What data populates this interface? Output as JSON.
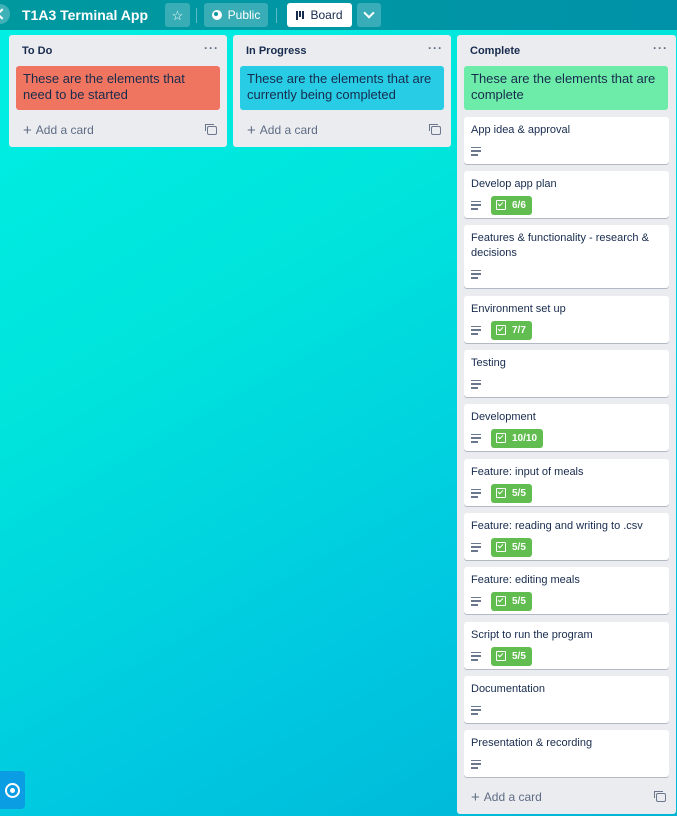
{
  "header": {
    "board_title": "T1A3 Terminal App",
    "visibility_label": "Public",
    "view_label": "Board"
  },
  "lists": [
    {
      "title": "To Do",
      "cover_card": {
        "text": "These are the elements that need to be started",
        "color": "#f07560"
      },
      "add_card_label": "Add a card"
    },
    {
      "title": "In Progress",
      "cover_card": {
        "text": "These are the elements that are currently being completed",
        "color": "#29cce5"
      },
      "add_card_label": "Add a card"
    },
    {
      "title": "Complete",
      "cover_card": {
        "text": "These are the elements that are complete",
        "color": "#6deca9"
      },
      "add_card_label": "Add a card",
      "cards": [
        {
          "title": "App idea & approval",
          "has_description": true,
          "checklist": null
        },
        {
          "title": "Develop app plan",
          "has_description": true,
          "checklist": "6/6"
        },
        {
          "title": "Features & functionality - research & decisions",
          "has_description": true,
          "checklist": null
        },
        {
          "title": "Environment set up",
          "has_description": true,
          "checklist": "7/7"
        },
        {
          "title": "Testing",
          "has_description": true,
          "checklist": null
        },
        {
          "title": "Development",
          "has_description": true,
          "checklist": "10/10"
        },
        {
          "title": "Feature: input of meals",
          "has_description": true,
          "checklist": "5/5"
        },
        {
          "title": "Feature: reading and writing to .csv",
          "has_description": true,
          "checklist": "5/5"
        },
        {
          "title": "Feature: editing meals",
          "has_description": true,
          "checklist": "5/5"
        },
        {
          "title": "Script to run the program",
          "has_description": true,
          "checklist": "5/5"
        },
        {
          "title": "Documentation",
          "has_description": true,
          "checklist": null
        },
        {
          "title": "Presentation & recording",
          "has_description": true,
          "checklist": null
        }
      ]
    }
  ],
  "colors": {
    "header_bg": "#0096a4",
    "checklist_complete": "#61bd4f",
    "list_bg": "#ebecf0"
  }
}
